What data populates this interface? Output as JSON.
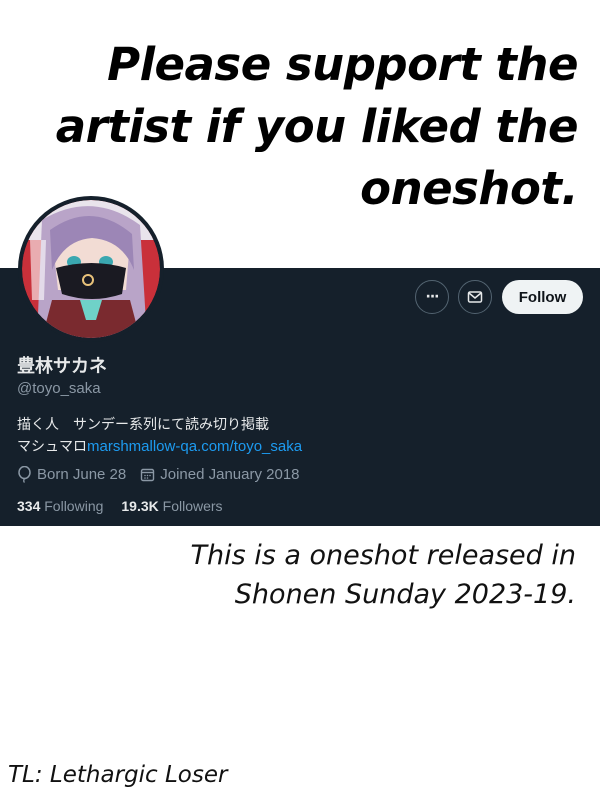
{
  "headline": {
    "lines": [
      "Please support the",
      "artist if you liked the",
      "oneshot."
    ]
  },
  "profile": {
    "display_name": "豊林サカネ",
    "handle": "@toyo_saka",
    "bio_line1": "描く人　サンデー系列にて読み切り掲載",
    "bio_line2_prefix": "マシュマロ",
    "bio_link": "marshmallow-qa.com/toyo_saka",
    "born": "Born June 28",
    "joined": "Joined January 2018",
    "following_count": "334",
    "following_label": "Following",
    "followers_count": "19.3K",
    "followers_label": "Followers",
    "follow_button": "Follow",
    "more_button_glyph": "···",
    "colors": {
      "background": "#15202b",
      "link": "#1d9bf0",
      "muted": "#8b98a5",
      "text": "#e7e9ea"
    }
  },
  "note": {
    "lines": [
      "This is a oneshot released in",
      "Shonen Sunday 2023-19."
    ]
  },
  "credit": "TL: Lethargic Loser"
}
